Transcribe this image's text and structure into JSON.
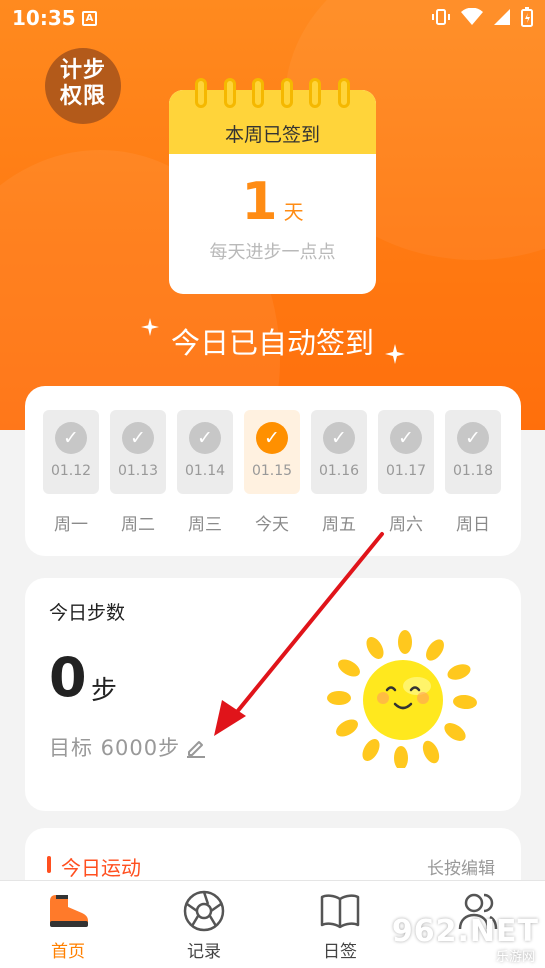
{
  "status_bar": {
    "time": "10:35",
    "notif_letter": "A"
  },
  "header": {
    "perm_badge_line1": "计步",
    "perm_badge_line2": "权限",
    "calendar_title": "本周已签到",
    "checkin_days": "1",
    "checkin_unit": "天",
    "calendar_subtitle": "每天进步一点点",
    "auto_sign_text": "今日已自动签到"
  },
  "week": {
    "days": [
      {
        "date": "01.12",
        "label": "周一",
        "today": false
      },
      {
        "date": "01.13",
        "label": "周二",
        "today": false
      },
      {
        "date": "01.14",
        "label": "周三",
        "today": false
      },
      {
        "date": "01.15",
        "label": "今天",
        "today": true
      },
      {
        "date": "01.16",
        "label": "周五",
        "today": false
      },
      {
        "date": "01.17",
        "label": "周六",
        "today": false
      },
      {
        "date": "01.18",
        "label": "周日",
        "today": false
      }
    ]
  },
  "steps": {
    "title": "今日步数",
    "count": "0",
    "unit": "步",
    "goal_label": "目标 6000步"
  },
  "activity": {
    "title": "今日运动",
    "edit_hint": "长按编辑"
  },
  "tabbar": {
    "tabs": [
      {
        "label": "首页",
        "icon": "shoe-icon"
      },
      {
        "label": "记录",
        "icon": "aperture-icon"
      },
      {
        "label": "日签",
        "icon": "book-icon"
      },
      {
        "label": "",
        "icon": "profile-icon"
      }
    ]
  },
  "watermark": {
    "main": "962.NET",
    "sub": "乐游网"
  },
  "colors": {
    "accent": "#ff8000",
    "header": "#ff7a12",
    "calendar_yellow": "#ffd43a",
    "today_check": "#ff9000",
    "activity_red": "#ff4f1f"
  }
}
